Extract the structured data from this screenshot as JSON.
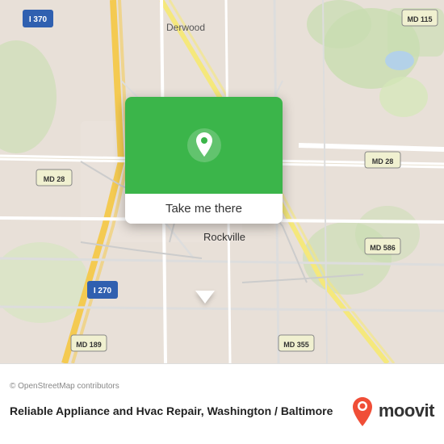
{
  "map": {
    "alt": "Map of Rockville, Washington/Baltimore area"
  },
  "popup": {
    "button_label": "Take me there"
  },
  "bottom": {
    "copyright": "© OpenStreetMap contributors",
    "location_title": "Reliable Appliance and Hvac Repair, Washington / Baltimore",
    "moovit_label": "moovit"
  },
  "colors": {
    "map_bg": "#e8e0d8",
    "green_header": "#3bb54a",
    "road_yellow": "#f5e87c",
    "road_white": "#ffffff",
    "highway_shield_bg": "#f0f0d0",
    "water": "#b3d1e8"
  }
}
